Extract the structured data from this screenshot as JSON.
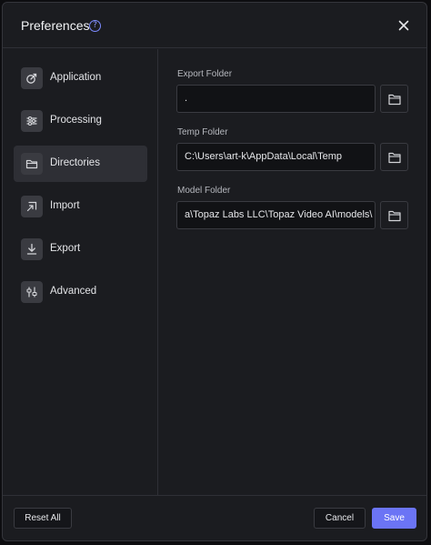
{
  "dialog": {
    "title": "Preferences",
    "help_glyph": "?"
  },
  "sidebar": {
    "items": [
      {
        "label": "Application",
        "icon": "application-icon",
        "active": false
      },
      {
        "label": "Processing",
        "icon": "sliders-icon",
        "active": false
      },
      {
        "label": "Directories",
        "icon": "folder-icon",
        "active": true
      },
      {
        "label": "Import",
        "icon": "import-icon",
        "active": false
      },
      {
        "label": "Export",
        "icon": "download-icon",
        "active": false
      },
      {
        "label": "Advanced",
        "icon": "advanced-icon",
        "active": false
      }
    ]
  },
  "directories": {
    "export_folder": {
      "label": "Export Folder",
      "value": "."
    },
    "temp_folder": {
      "label": "Temp Folder",
      "value": "C:\\Users\\art-k\\AppData\\Local\\Temp"
    },
    "model_folder": {
      "label": "Model Folder",
      "value": "a\\Topaz Labs LLC\\Topaz Video AI\\models\\"
    }
  },
  "footer": {
    "reset_label": "Reset All",
    "cancel_label": "Cancel",
    "save_label": "Save"
  },
  "colors": {
    "accent": "#6b74f5",
    "background": "#1b1c20",
    "active_item": "#2e2f35"
  }
}
